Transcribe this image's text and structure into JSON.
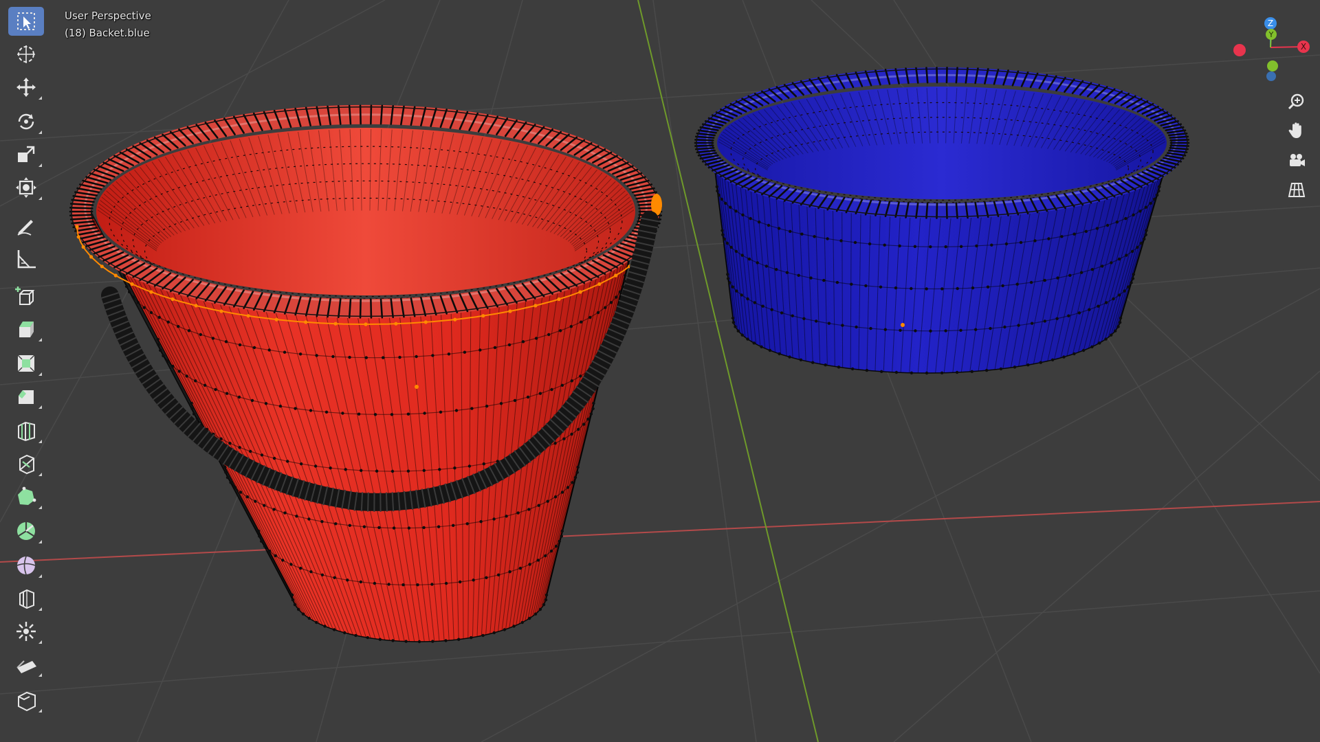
{
  "viewport": {
    "view_name": "User Perspective",
    "object_info": "(18) Backet.blue"
  },
  "toolbar": {
    "tools": [
      {
        "name": "select-box-icon",
        "active": true
      },
      {
        "name": "cursor-icon",
        "active": false
      },
      {
        "name": "move-icon",
        "active": false
      },
      {
        "name": "rotate-icon",
        "active": false
      },
      {
        "name": "scale-icon",
        "active": false
      },
      {
        "name": "transform-icon",
        "active": false
      },
      {
        "name": "annotate-icon",
        "active": false
      },
      {
        "name": "measure-icon",
        "active": false
      },
      {
        "name": "add-cube-icon",
        "active": false
      },
      {
        "name": "extrude-region-icon",
        "active": false
      },
      {
        "name": "inset-faces-icon",
        "active": false
      },
      {
        "name": "bevel-icon",
        "active": false
      },
      {
        "name": "loop-cut-icon",
        "active": false
      },
      {
        "name": "knife-icon",
        "active": false
      },
      {
        "name": "poly-build-icon",
        "active": false
      },
      {
        "name": "spin-icon",
        "active": false
      },
      {
        "name": "smooth-icon",
        "active": false
      },
      {
        "name": "edge-slide-icon",
        "active": false
      },
      {
        "name": "shrink-fatten-icon",
        "active": false
      },
      {
        "name": "shear-icon",
        "active": false
      },
      {
        "name": "rip-region-icon",
        "active": false
      }
    ]
  },
  "gizmo": {
    "axes": [
      "X",
      "Y",
      "Z"
    ],
    "colors": {
      "x": "#e8344d",
      "y": "#82c02c",
      "z": "#3a8ee8"
    }
  },
  "nav_buttons": [
    "zoom-icon",
    "pan-hand-icon",
    "camera-icon",
    "ortho-grid-icon"
  ],
  "colors": {
    "background": "#3d3d3d",
    "grid": "#4a4a4a",
    "x_axis": "#b34a4a",
    "y_axis": "#6f9a2a",
    "bucket_red": "#d9261c",
    "bucket_blue": "#1f1fbf",
    "handle": "#151515",
    "selection": "#ff8a00",
    "active_tool": "#5a7fc2"
  },
  "objects": [
    {
      "name": "red-bucket"
    },
    {
      "name": "blue-bucket"
    }
  ]
}
